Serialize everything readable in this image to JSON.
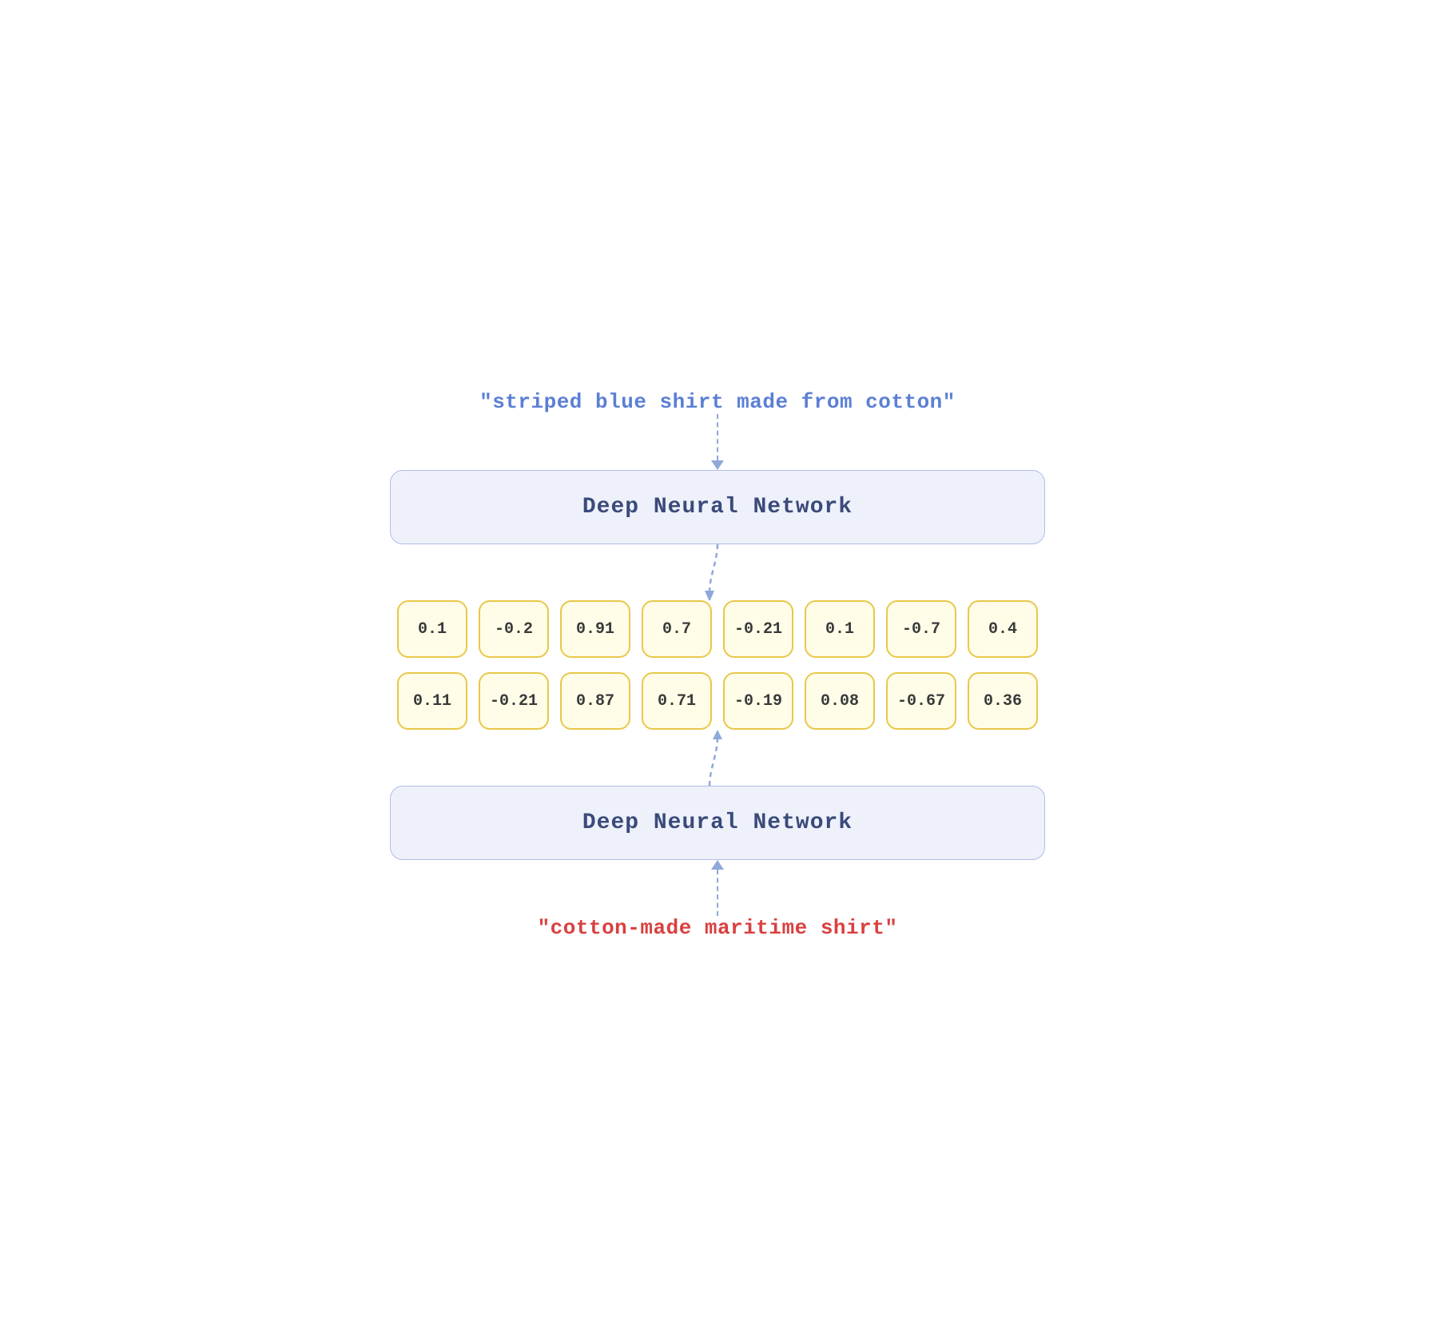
{
  "input_text": "\"striped blue shirt made from cotton\"",
  "output_text": "\"cotton-made maritime shirt\"",
  "dnn_top_label": "Deep Neural Network",
  "dnn_bottom_label": "Deep Neural Network",
  "vector_row1": [
    "0.1",
    "-0.2",
    "0.91",
    "0.7",
    "-0.21",
    "0.1",
    "-0.7",
    "0.4"
  ],
  "vector_row2": [
    "0.11",
    "-0.21",
    "0.87",
    "0.71",
    "-0.19",
    "0.08",
    "-0.67",
    "0.36"
  ]
}
